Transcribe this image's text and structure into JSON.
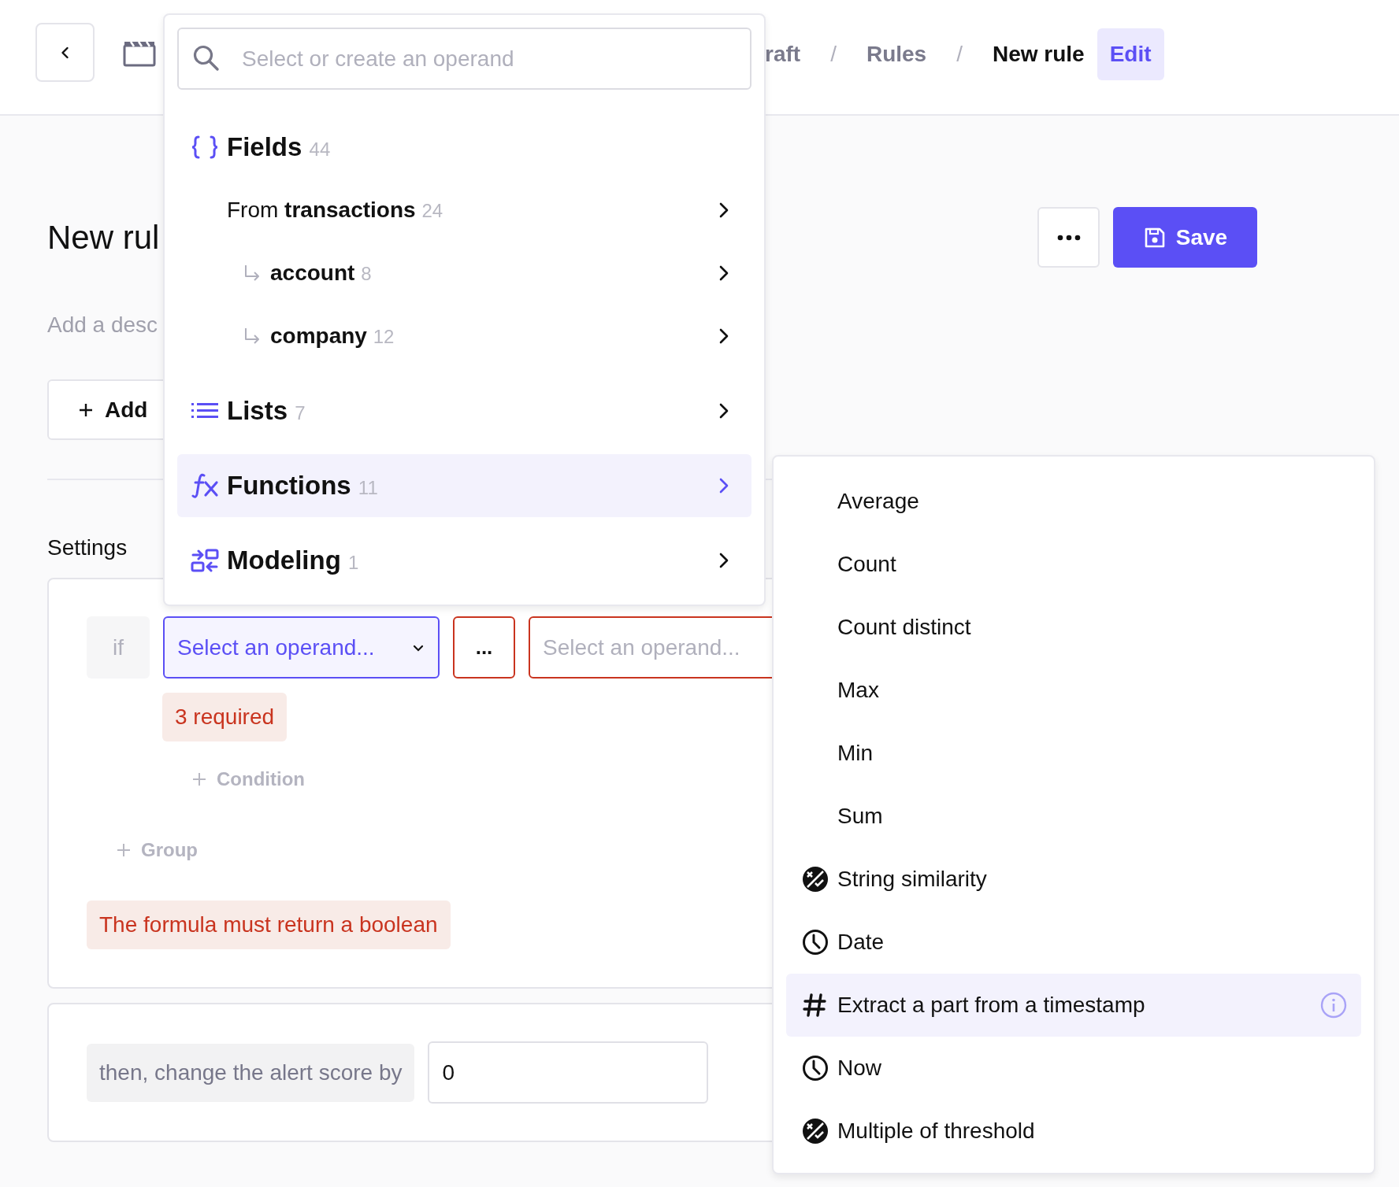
{
  "header": {
    "breadcrumbs": [
      {
        "label": "raft",
        "current": false
      },
      {
        "label": "Rules",
        "current": false
      },
      {
        "label": "New rule",
        "current": true
      }
    ],
    "separators": [
      "/",
      "/"
    ],
    "badge": "Edit"
  },
  "page": {
    "title": "New rul",
    "description_placeholder": "Add a desc",
    "add_button": "Add",
    "settings_label": "Settings",
    "save_button": "Save"
  },
  "condition": {
    "keyword": "if",
    "left_operand": {
      "text": "Select an operand...",
      "active": true
    },
    "operator": {
      "text": "...",
      "invalid": true
    },
    "right_operand": {
      "text": "Select an operand...",
      "invalid": true
    },
    "error": "3 required",
    "add_condition": "Condition",
    "add_group": "Group",
    "formula_error": "The formula must return a boolean"
  },
  "consequence": {
    "label": "then, change the alert score by",
    "value": "0"
  },
  "operand_menu": {
    "search": {
      "placeholder": "Select or create an operand"
    },
    "sections": [
      {
        "kind": "fields",
        "label": "Fields",
        "count": "44",
        "selected": false,
        "children": [
          {
            "label": "From **transactions**",
            "count": "24",
            "selected": false,
            "children": [
              {
                "label": "account",
                "count": "8",
                "selected": false
              },
              {
                "label": "company",
                "count": "12",
                "selected": false
              }
            ]
          }
        ]
      },
      {
        "kind": "lists",
        "label": "Lists",
        "count": "7",
        "selected": false
      },
      {
        "kind": "functions",
        "label": "Functions",
        "count": "11",
        "selected": true
      },
      {
        "kind": "modeling",
        "label": "Modeling",
        "count": "1",
        "selected": false
      }
    ]
  },
  "functions_menu": {
    "items": [
      {
        "kind": "plain",
        "label": "Average",
        "selected": false
      },
      {
        "kind": "plain",
        "label": "Count",
        "selected": false
      },
      {
        "kind": "plain",
        "label": "Count distinct",
        "selected": false
      },
      {
        "kind": "plain",
        "label": "Max",
        "selected": false
      },
      {
        "kind": "plain",
        "label": "Min",
        "selected": false
      },
      {
        "kind": "plain",
        "label": "Sum",
        "selected": false
      },
      {
        "kind": "similarity",
        "label": "String similarity",
        "selected": false
      },
      {
        "kind": "clock",
        "label": "Date",
        "selected": false
      },
      {
        "kind": "hash",
        "label": "Extract a part from a timestamp",
        "selected": true
      },
      {
        "kind": "clock",
        "label": "Now",
        "selected": false
      },
      {
        "kind": "similarity",
        "label": "Multiple of threshold",
        "selected": false
      }
    ]
  }
}
